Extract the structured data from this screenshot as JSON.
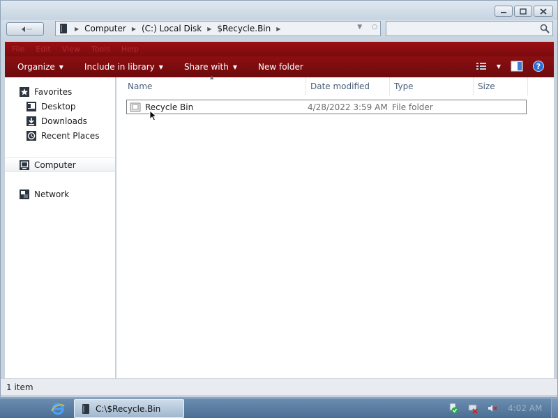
{
  "address": {
    "crumbs": [
      "Computer",
      "(C:) Local Disk",
      "$Recycle.Bin"
    ]
  },
  "search": {
    "placeholder": ""
  },
  "menubar": [
    "File",
    "Edit",
    "View",
    "Tools",
    "Help"
  ],
  "commands": {
    "organize": "Organize",
    "include_in_library": "Include in library",
    "share_with": "Share with",
    "new_folder": "New folder"
  },
  "nav": {
    "favorites": "Favorites",
    "desktop": "Desktop",
    "downloads": "Downloads",
    "recent_places": "Recent Places",
    "computer": "Computer",
    "network": "Network"
  },
  "columns": {
    "name": "Name",
    "date_modified": "Date modified",
    "type": "Type",
    "size": "Size"
  },
  "files": [
    {
      "name": "Recycle Bin",
      "date_modified": "4/28/2022 3:59 AM",
      "type": "File folder",
      "size": ""
    }
  ],
  "status": {
    "item_count": "1 item"
  },
  "taskbar": {
    "task_title": "C:\\$Recycle.Bin",
    "clock": "4:02 AM"
  },
  "icons": {
    "help": "?",
    "back": "back-arrow-icon",
    "search": "search-icon"
  },
  "colors": {
    "command_bar": "#7a0b0e",
    "taskbar": "#5a7fa5",
    "header_text": "#4c607a"
  }
}
